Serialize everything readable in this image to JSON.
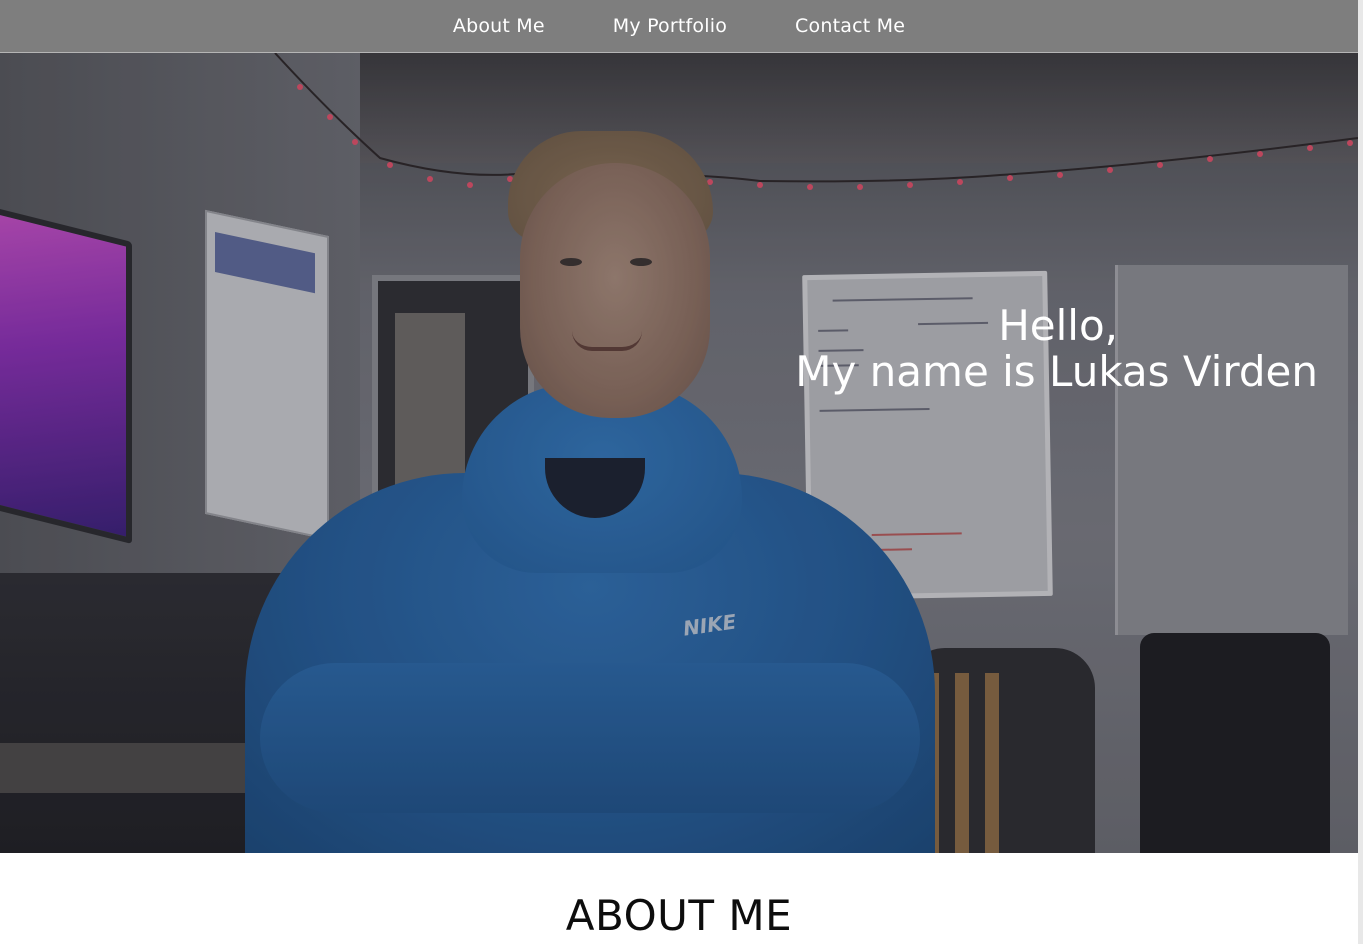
{
  "nav": {
    "links": [
      {
        "label": "About Me"
      },
      {
        "label": "My Portfolio"
      },
      {
        "label": "Contact Me"
      }
    ]
  },
  "hero": {
    "greeting": "Hello,",
    "intro": "My name is Lukas Virden",
    "sweatshirt_logo": "NIKE",
    "colors": {
      "hoodie": "#2a67a6",
      "overlay": "#1e1e28",
      "string_lights": "#e0516a"
    }
  },
  "about": {
    "heading": "ABOUT ME"
  },
  "theme": {
    "nav_bg": "#7e7e7e",
    "nav_text": "#ffffff",
    "page_bg": "#ffffff",
    "heading_text": "#0d0d0d"
  }
}
